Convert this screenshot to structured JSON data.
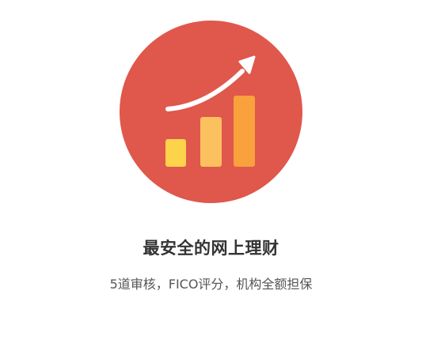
{
  "feature": {
    "icon": "growth-chart-icon",
    "title": "最安全的网上理财",
    "description": "5道审核，FICO评分，机构全额担保"
  },
  "colors": {
    "circle": "#E0574C",
    "bar_small": "#FCD34B",
    "bar_medium": "#FBC15F",
    "bar_large": "#F8A13D",
    "arrow": "#FFFFFF",
    "title": "#333333",
    "description": "#555555"
  }
}
